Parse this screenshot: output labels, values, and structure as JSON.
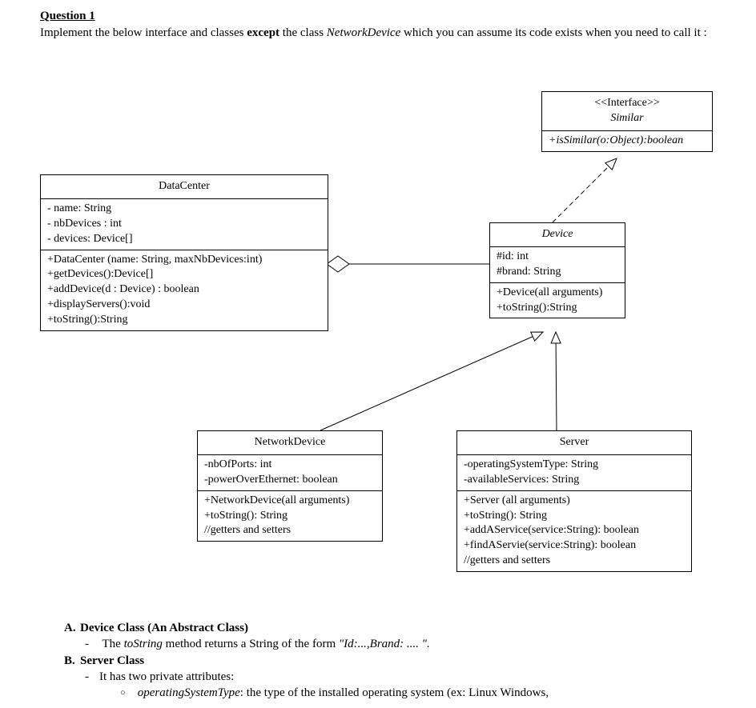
{
  "question": {
    "heading": "Question 1",
    "prompt_pre": "Implement the below interface and classes ",
    "prompt_bold": "except",
    "prompt_mid": " the class ",
    "prompt_ital": "NetworkDevice",
    "prompt_post": " which you can assume its code exists when you need to call it  :"
  },
  "uml": {
    "similar": {
      "stereotype": "<<Interface>>",
      "name": "Similar",
      "methods": [
        "+isSimilar(o:Object):boolean"
      ]
    },
    "dataCenter": {
      "name": "DataCenter",
      "attrs": [
        "- name: String",
        "- nbDevices : int",
        "- devices: Device[]"
      ],
      "methods": [
        "+DataCenter (name: String, maxNbDevices:int)",
        "+getDevices():Device[]",
        "+addDevice(d : Device) : boolean",
        "+displayServers():void",
        "+toString():String"
      ]
    },
    "device": {
      "name": "Device",
      "attrs": [
        "#id: int",
        "#brand: String"
      ],
      "methods": [
        "+Device(all arguments)",
        "+toString():String"
      ]
    },
    "networkDevice": {
      "name": "NetworkDevice",
      "attrs": [
        "-nbOfPorts: int",
        "-powerOverEthernet: boolean"
      ],
      "methods": [
        "+NetworkDevice(all arguments)",
        "+toString(): String",
        "//getters and setters"
      ]
    },
    "server": {
      "name": "Server",
      "attrs": [
        "-operatingSystemType: String",
        "-availableServices: String"
      ],
      "methods": [
        "+Server (all arguments)",
        "+toString(): String",
        "+addAService(service:String): boolean",
        "+findAServie(service:String): boolean",
        "//getters and setters"
      ]
    }
  },
  "notes": {
    "a_head_letter": "A.",
    "a_head": "Device Class (An Abstract Class)",
    "a_dash_1_pre": "The ",
    "a_dash_1_ital1": "toString",
    "a_dash_1_mid": " method returns a String of the form ",
    "a_dash_1_ital2": "\"Id:...,Brand: .... \".",
    "b_head_letter": "B.",
    "b_head": "Server Class",
    "b_dash_1": "It has two private attributes:",
    "b_circ_1_ital": "operatingSystemType",
    "b_circ_1_post": ": the type of the installed operating system (ex: Linux Windows,"
  }
}
